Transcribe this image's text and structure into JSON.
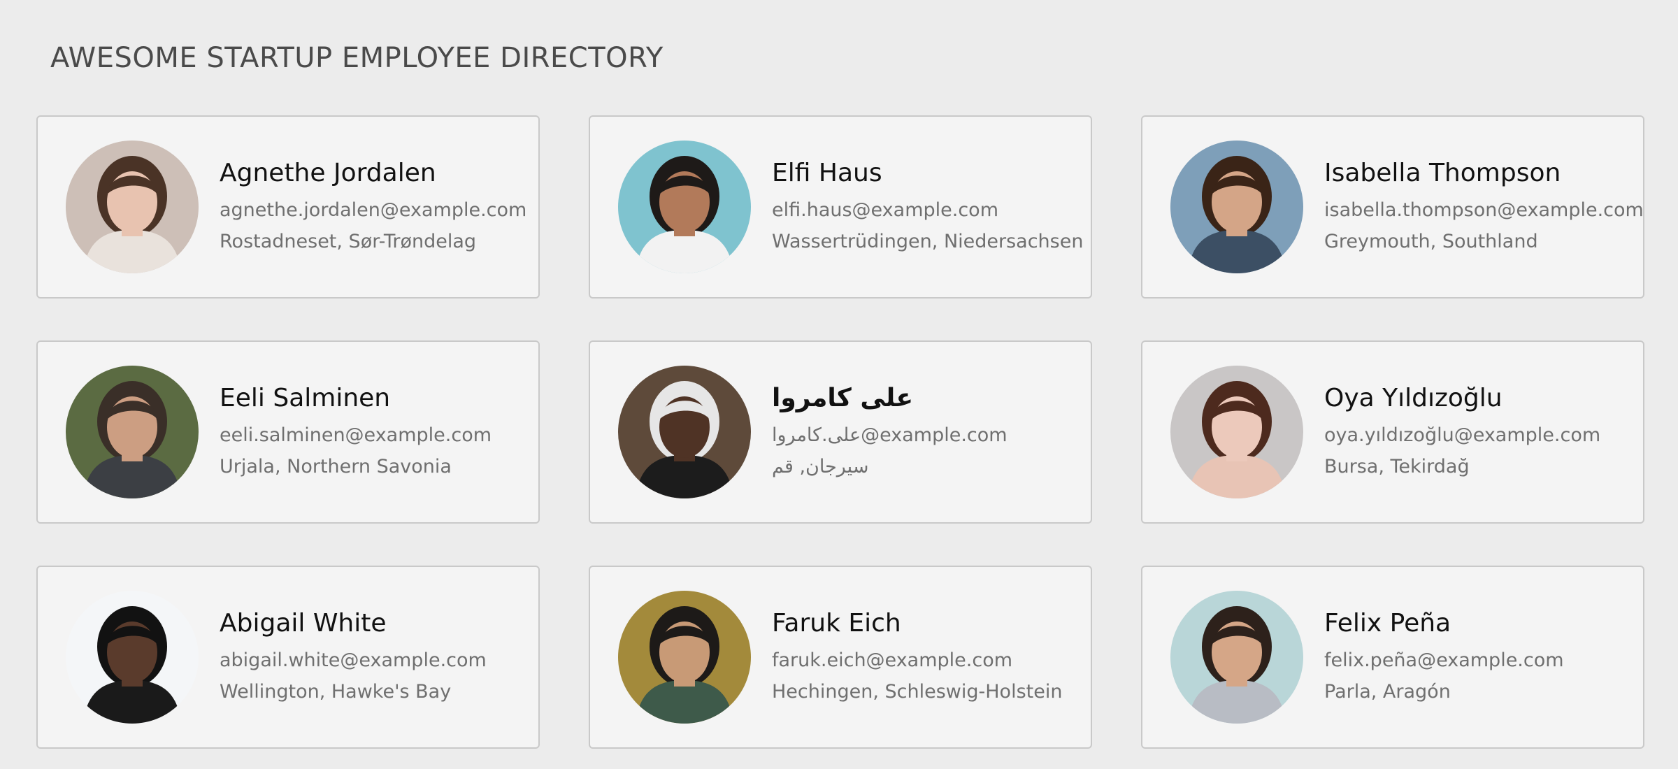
{
  "header": {
    "title": "AWESOME STARTUP EMPLOYEE DIRECTORY"
  },
  "employees": [
    {
      "name": "Agnethe Jordalen",
      "email": "agnethe.jordalen@example.com",
      "location": "Rostadneset, Sør-Trøndelag",
      "bg": "#cdbfb7",
      "hair": "#4a3326",
      "skin": "#e8c3b0",
      "shirt": "#e9e2dc"
    },
    {
      "name": "Elfi Haus",
      "email": "elfi.haus@example.com",
      "location": "Wassertrüdingen, Niedersachsen",
      "bg": "#7fc3cf",
      "hair": "#1e1a18",
      "skin": "#b27a5a",
      "shirt": "#f2f2f2"
    },
    {
      "name": "Isabella Thompson",
      "email": "isabella.thompson@example.com",
      "location": "Greymouth, Southland",
      "bg": "#7e9fb9",
      "hair": "#3a2417",
      "skin": "#d4a587",
      "shirt": "#3c4f64"
    },
    {
      "name": "Eeli Salminen",
      "email": "eeli.salminen@example.com",
      "location": "Urjala, Northern Savonia",
      "bg": "#5b6b42",
      "hair": "#3a2f28",
      "skin": "#cc9e82",
      "shirt": "#3c3f44"
    },
    {
      "name": "علی کامروا",
      "email": "علی.کامروا@example.com",
      "location": "سیرجان, قم",
      "bg": "#5e4a3a",
      "hair": "#e6e6e6",
      "skin": "#4f3325",
      "shirt": "#1c1c1c"
    },
    {
      "name": "Oya Yıldızoğlu",
      "email": "oya.yıldızoğlu@example.com",
      "location": "Bursa, Tekirdağ",
      "bg": "#c9c6c6",
      "hair": "#4d2a1e",
      "skin": "#ecc9bb",
      "shirt": "#e8c4b5"
    },
    {
      "name": "Abigail White",
      "email": "abigail.white@example.com",
      "location": "Wellington, Hawke's Bay",
      "bg": "#f4f6f8",
      "hair": "#121212",
      "skin": "#5a3b2c",
      "shirt": "#1a1a1a"
    },
    {
      "name": "Faruk Eich",
      "email": "faruk.eich@example.com",
      "location": "Hechingen, Schleswig-Holstein",
      "bg": "#a38a3b",
      "hair": "#1d1a18",
      "skin": "#c89a76",
      "shirt": "#3e5a4a"
    },
    {
      "name": "Felix Peña",
      "email": "felix.peña@example.com",
      "location": "Parla, Aragón",
      "bg": "#b9d6d8",
      "hair": "#2d211b",
      "skin": "#d5a687",
      "shirt": "#b8bcc4"
    }
  ]
}
